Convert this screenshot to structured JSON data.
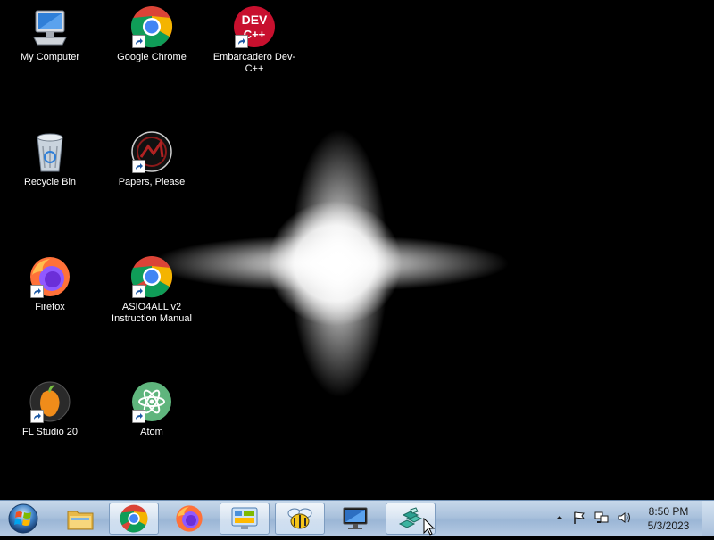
{
  "desktop": {
    "icons": [
      {
        "label": "My Computer",
        "icon": "my-computer-icon"
      },
      {
        "label": "Google Chrome",
        "icon": "chrome-icon"
      },
      {
        "label": "Embarcadero Dev-C++",
        "icon": "dev-cpp-icon"
      },
      {
        "label": "Recycle Bin",
        "icon": "recycle-bin-icon"
      },
      {
        "label": "Papers, Please",
        "icon": "papers-please-icon"
      },
      {
        "label": "Firefox",
        "icon": "firefox-icon"
      },
      {
        "label": "ASIO4ALL v2\nInstruction Manual",
        "icon": "chrome-icon"
      },
      {
        "label": "FL Studio 20",
        "icon": "fl-studio-icon"
      },
      {
        "label": "Atom",
        "icon": "atom-icon"
      }
    ],
    "devcpp_badge_text": "DEV\nC++"
  },
  "taskbar": {
    "start_icon": "windows-orb-icon",
    "buttons": [
      {
        "icon": "file-explorer-icon",
        "active": false
      },
      {
        "icon": "chrome-icon",
        "active": true
      },
      {
        "icon": "firefox-icon",
        "active": false
      },
      {
        "icon": "control-panel-icon",
        "active": true
      },
      {
        "icon": "bee-app-icon",
        "active": true
      },
      {
        "icon": "monitor-icon",
        "active": false
      },
      {
        "icon": "blocks-app-icon",
        "active": true
      }
    ],
    "tray": {
      "icons": [
        "show-hidden-icons-arrow",
        "action-center-flag-icon",
        "network-icon",
        "volume-icon"
      ],
      "time": "8:50 PM",
      "date": "5/3/2023"
    }
  },
  "colors": {
    "desktop_bg": "#000000",
    "taskbar_top": "#c7d8ea",
    "taskbar_bottom": "#9bb6d6",
    "label_text": "#ffffff"
  }
}
